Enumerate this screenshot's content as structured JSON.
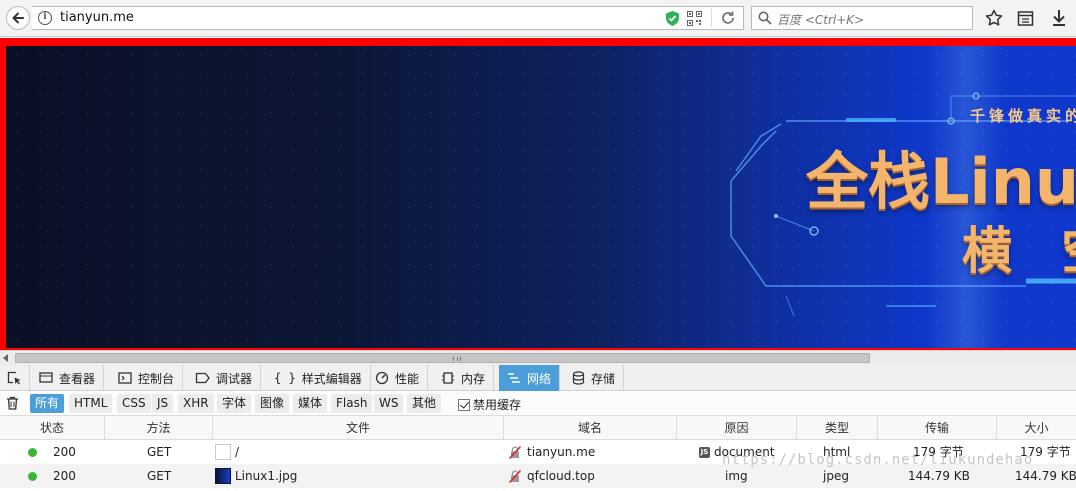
{
  "browser": {
    "url": "tianyun.me",
    "search_placeholder": "百度 <Ctrl+K>"
  },
  "banner": {
    "tagline": "千锋做真实的",
    "headline": "全栈Linux",
    "subline": "横 空"
  },
  "devtools": {
    "tabs": [
      {
        "label": "查看器",
        "icon": "inspector-icon"
      },
      {
        "label": "控制台",
        "icon": "console-icon"
      },
      {
        "label": "调试器",
        "icon": "debugger-icon"
      },
      {
        "label": "样式编辑器",
        "icon": "style-editor-icon"
      },
      {
        "label": "性能",
        "icon": "performance-icon"
      },
      {
        "label": "内存",
        "icon": "memory-icon"
      },
      {
        "label": "网络",
        "icon": "network-icon",
        "active": true
      },
      {
        "label": "存储",
        "icon": "storage-icon"
      }
    ],
    "filters": [
      "所有",
      "HTML",
      "CSS",
      "JS",
      "XHR",
      "字体",
      "图像",
      "媒体",
      "Flash",
      "WS",
      "其他"
    ],
    "active_filter": "所有",
    "disable_cache_label": "禁用缓存",
    "disable_cache_checked": true,
    "columns": [
      "状态",
      "方法",
      "文件",
      "域名",
      "原因",
      "类型",
      "传输",
      "大小"
    ],
    "rows": [
      {
        "status": "200",
        "method": "GET",
        "file": "/",
        "domain": "tianyun.me",
        "cause": "document",
        "type": "html",
        "transferred": "179 字节",
        "size": "179 字节"
      },
      {
        "status": "200",
        "method": "GET",
        "file": "Linux1.jpg",
        "domain": "qfcloud.top",
        "cause": "img",
        "type": "jpeg",
        "transferred": "144.79 KB",
        "size": "144.79 KB"
      }
    ]
  },
  "watermark": "https://blog.csdn.net/liukundehao",
  "colors": {
    "accent": "#4c9ed9",
    "status_ok": "#3cb533",
    "page_border": "#ff0000"
  }
}
